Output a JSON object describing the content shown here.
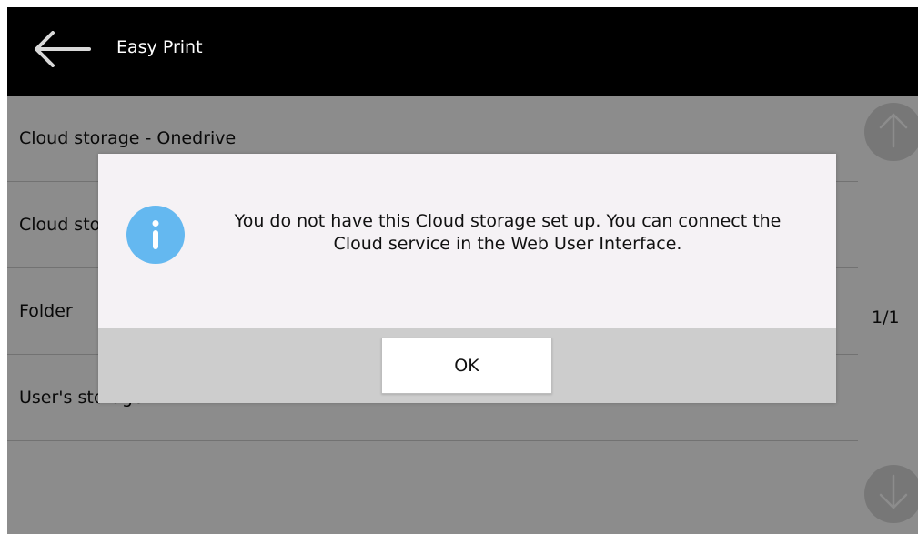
{
  "header": {
    "title": "Easy Print",
    "back_icon": "arrow-left-icon"
  },
  "list": {
    "items": [
      {
        "label": "Cloud storage - Onedrive"
      },
      {
        "label": "Cloud storage - Google Drive"
      },
      {
        "label": "Folder"
      },
      {
        "label": "User's storage"
      },
      {
        "label": ""
      }
    ]
  },
  "scroll": {
    "up_icon": "arrow-up-icon",
    "down_icon": "arrow-down-icon",
    "page_indicator": "1/1"
  },
  "dialog": {
    "icon": "info-icon",
    "message": "You do not have this Cloud storage set up. You can connect the Cloud service in the Web User Interface.",
    "ok_label": "OK",
    "icon_color": "#64b8f0"
  }
}
